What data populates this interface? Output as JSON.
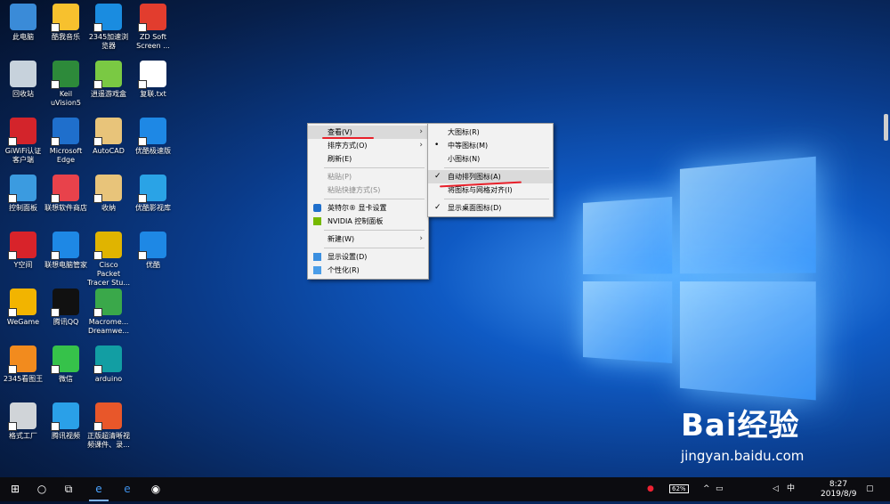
{
  "desktop_icons": [
    {
      "label": "此电脑",
      "color": "#3a8bd8"
    },
    {
      "label": "酷我音乐",
      "color": "#f7c12e"
    },
    {
      "label": "2345加速浏览器",
      "color": "#1a8ce0"
    },
    {
      "label": "ZD Soft Screen ...",
      "color": "#e23d2e"
    },
    {
      "label": "回收站",
      "color": "#c7d2dc"
    },
    {
      "label": "Keil uVision5",
      "color": "#2d8a3a"
    },
    {
      "label": "逍遥游戏盒",
      "color": "#7ac943"
    },
    {
      "label": "复联.txt",
      "color": "#ffffff"
    },
    {
      "label": "GiWiFi认证客户端",
      "color": "#d3242b"
    },
    {
      "label": "Microsoft Edge",
      "color": "#1f6fcc"
    },
    {
      "label": "AutoCAD",
      "color": "#e8c47a"
    },
    {
      "label": "优酷极速版",
      "color": "#1e88e5"
    },
    {
      "label": "控制面板",
      "color": "#3b9be0"
    },
    {
      "label": "联想软件商店",
      "color": "#e8424b"
    },
    {
      "label": "收纳",
      "color": "#e8c47a"
    },
    {
      "label": "优酷影视库",
      "color": "#2aa3e6"
    },
    {
      "label": "Y空间",
      "color": "#d8232a"
    },
    {
      "label": "联想电脑管家",
      "color": "#1e88e5"
    },
    {
      "label": "Cisco Packet Tracer Stu...",
      "color": "#e0b400"
    },
    {
      "label": "优酷",
      "color": "#1e88e5"
    },
    {
      "label": "WeGame",
      "color": "#f2b400"
    },
    {
      "label": "腾讯QQ",
      "color": "#111111"
    },
    {
      "label": "Macrome... Dreamwe...",
      "color": "#3aa84a"
    },
    {
      "label": "2345看图王",
      "color": "#f28b1e"
    },
    {
      "label": "微信",
      "color": "#36c24a"
    },
    {
      "label": "arduino",
      "color": "#129ea3"
    },
    {
      "label": "格式工厂",
      "color": "#d0d4d8"
    },
    {
      "label": "腾讯视频",
      "color": "#2aa0e8"
    },
    {
      "label": "正版超清晰视频课件、录...",
      "color": "#e8572a"
    }
  ],
  "context_menu": {
    "items": [
      {
        "label": "查看(V)",
        "has_submenu": true,
        "highlighted": true
      },
      {
        "label": "排序方式(O)",
        "has_submenu": true
      },
      {
        "label": "刷新(E)"
      },
      {
        "label": "粘贴(P)",
        "disabled": true
      },
      {
        "label": "粘贴快捷方式(S)",
        "disabled": true
      },
      {
        "label": "英特尔® 显卡设置",
        "icon": "intel-icon"
      },
      {
        "label": "NVIDIA 控制面板",
        "icon": "nvidia-icon"
      },
      {
        "label": "新建(W)",
        "has_submenu": true
      },
      {
        "label": "显示设置(D)",
        "icon": "display-icon"
      },
      {
        "label": "个性化(R)",
        "icon": "personalize-icon"
      }
    ]
  },
  "submenu": {
    "items": [
      {
        "label": "大图标(R)"
      },
      {
        "label": "中等图标(M)",
        "mark": "•"
      },
      {
        "label": "小图标(N)"
      },
      {
        "label": "自动排列图标(A)",
        "mark": "✓",
        "highlighted": true
      },
      {
        "label": "将图标与网格对齐(I)"
      },
      {
        "label": "显示桌面图标(D)",
        "mark": "✓"
      }
    ]
  },
  "taskbar": {
    "start_icon": "windows-logo-icon",
    "battery": "62%",
    "ime": "中",
    "time": "8:27",
    "date": "2019/8/9"
  },
  "watermark": {
    "brand": "Bai经验",
    "url": "jingyan.baidu.com"
  }
}
